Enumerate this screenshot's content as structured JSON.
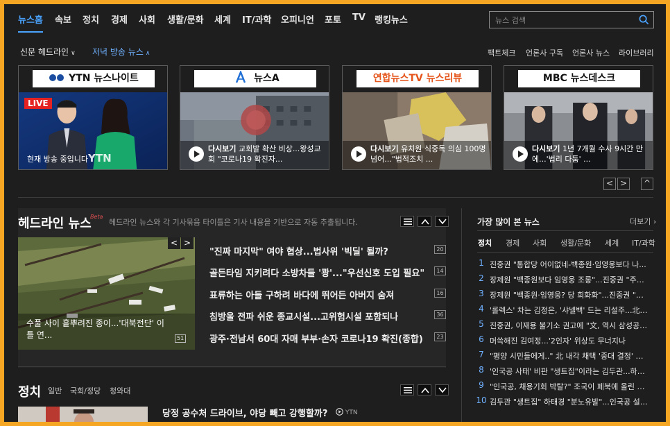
{
  "nav": {
    "items": [
      "뉴스홈",
      "속보",
      "정치",
      "경제",
      "사회",
      "생활/문화",
      "세계",
      "IT/과학",
      "오피니언",
      "포토",
      "TV",
      "랭킹뉴스"
    ],
    "search_placeholder": "뉴스 검색"
  },
  "subnav": {
    "dropdown1": "신문 헤드라인",
    "dropdown2": "저녁 방송 뉴스",
    "right_links": [
      "팩트체크",
      "언론사 구독",
      "언론사 뉴스",
      "라이브러리"
    ]
  },
  "broadcast_cards": [
    {
      "logo": "YTN 뉴스나이트",
      "live_badge": "LIVE",
      "caption": "현재 방송 중입니다",
      "watermark": "YTN"
    },
    {
      "logo": "뉴스A",
      "caption_bold": "다시보기",
      "caption": " 교회발 확산 비상...왕성교회 \"코로나19 확진자..."
    },
    {
      "logo": "연합뉴스TV 뉴스리뷰",
      "caption_bold": "다시보기",
      "caption": " 유치원 식중독 의심 100명 넘어...\"법적조치 ..."
    },
    {
      "logo": "MBC 뉴스데스크",
      "caption_bold": "다시보기",
      "caption": " 1년 7개월 수사 9시간 만에...'법리 다툼' ..."
    }
  ],
  "pager": {
    "prev": "<",
    "next": ">",
    "collapse": "^"
  },
  "headline": {
    "title": "헤드라인 뉴스",
    "beta": "Beta",
    "description": "헤드라인 뉴스와 각 기사묶음 타이틀은 기사 내용을 기반으로 자동 추출됩니다.",
    "photo_caption": "수풀 사이 흩뿌려진 종이...'대북전단' 이틀 연...",
    "photo_count": "51",
    "items": [
      {
        "text": "\"진짜 마지막\" 여야 협상...법사위 '빅딜' 될까?",
        "count": "20"
      },
      {
        "text": "골든타임 지키려다 소방차들 '쾅'...\"우선신호 도입 필요\"",
        "count": "14"
      },
      {
        "text": "표류하는 아들 구하려 바다에 뛰어든 아버지 숨져",
        "count": "16"
      },
      {
        "text": "침방울 전파 쉬운 종교시설...고위험시설 포함되나",
        "count": "36"
      },
      {
        "text": "광주·전남서 60대 자매 부부·손자 코로나19 확진(종합)",
        "count": "23"
      }
    ]
  },
  "politics": {
    "title": "정치",
    "tabs": [
      "일반",
      "국회/정당",
      "청와대"
    ],
    "item": "당정 공수처 드라이브, 야당 빼고 강행할까?",
    "source": "YTN"
  },
  "most_viewed": {
    "title": "가장 많이 본 뉴스",
    "more": "더보기",
    "tabs": [
      "정치",
      "경제",
      "사회",
      "생활/문화",
      "세계",
      "IT/과학"
    ],
    "items": [
      "진중권 \"통합당 어이없네-백종원·임영웅보다 나...",
      "장제원 \"백종원보다 임영웅 조롱\"...진중권 \"주제 ...",
      "장제원 \"백종원·임영웅? 당 희화화\"...진중권 \"정신...",
      "'롤렉스' 차는 김정은, '샤넬백' 드는 리설주...北의 ...",
      "진중권, 이재용 불기소 권고에 \"文, 역시 삼성공화...",
      "머쓱해진 김여정...'2인자' 위상도 무너지나",
      "\"평양 시민들에게..\" 北 내각 채택 '중대 결정' 내...",
      "'인국공 사태' 비판 \"생트집\"이라는 김두관...하태...",
      "\"인국공, 채용기회 박탈?\" 조국이 페북에 올린 사진",
      "김두관 \"생트집\" 하태경 \"분노유발\"...인국공 설전..."
    ]
  },
  "colors": {
    "accent": "#4aa3ff",
    "background": "#1e1e1f",
    "border": "#f5a623",
    "live": "#e52222"
  }
}
